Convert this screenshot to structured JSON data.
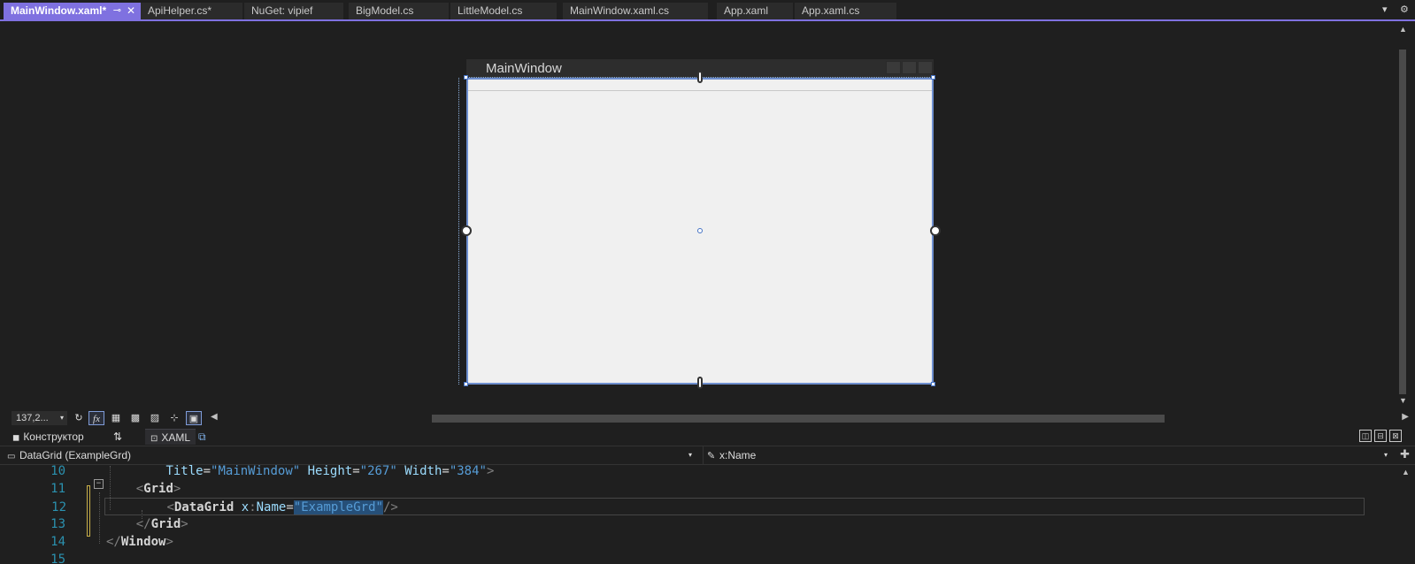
{
  "tabs": [
    {
      "label": "MainWindow.xaml*",
      "active": true
    },
    {
      "label": "ApiHelper.cs*"
    },
    {
      "label": "NuGet: vipief"
    },
    {
      "label": "BigModel.cs"
    },
    {
      "label": "LittleModel.cs"
    },
    {
      "label": "MainWindow.xaml.cs"
    },
    {
      "label": "App.xaml"
    },
    {
      "label": "App.xaml.cs"
    }
  ],
  "tab_icons": {
    "pin": "pin-icon",
    "close": "close-icon",
    "overflow": "chevron-down-icon",
    "settings": "gear-icon"
  },
  "tab_glyphs": {
    "pin": "⊸",
    "close": "✕",
    "overflow": "▾",
    "settings": "⚙"
  },
  "designer": {
    "window_title": "MainWindow",
    "colors": {
      "accent": "#7f71e0",
      "selection": "#6e8fcf",
      "window_background": "#f0f0f0"
    }
  },
  "designer_toolbar": {
    "zoom_value": "137,2...",
    "buttons": [
      {
        "name": "refresh-icon",
        "glyph": "↻"
      },
      {
        "name": "effects-toggle-icon",
        "glyph": "fx"
      },
      {
        "name": "grid-icon",
        "glyph": "▦"
      },
      {
        "name": "layout-grid-icon",
        "glyph": "▩"
      },
      {
        "name": "artboard-icon",
        "glyph": "▨"
      },
      {
        "name": "snap-icon",
        "glyph": "⊹"
      },
      {
        "name": "snap-gridlines-icon",
        "glyph": "▣"
      }
    ]
  },
  "split": {
    "designer_tab": "Конструктор",
    "swap_glyph": "⇅",
    "xaml_tab": "XAML",
    "popout_glyph": "⧉",
    "layout_buttons": [
      "◫",
      "⊟",
      "⊠"
    ]
  },
  "navbar": {
    "element": "DataGrid (ExampleGrd)",
    "member": "x:Name",
    "dropdown_glyph": "▾",
    "wrench_glyph": "✎",
    "element_glyph": "▭",
    "plus_glyph": "✚"
  },
  "code_lines": [
    {
      "number": "10",
      "indent": "        ",
      "tokens": [
        {
          "t": "Title",
          "c": "t-attr"
        },
        {
          "t": "=",
          "c": "t-eq"
        },
        {
          "t": "\"MainWindow\"",
          "c": "t-val"
        },
        {
          "t": " ",
          "c": "t-eq"
        },
        {
          "t": "Height",
          "c": "t-attr"
        },
        {
          "t": "=",
          "c": "t-eq"
        },
        {
          "t": "\"267\"",
          "c": "t-val"
        },
        {
          "t": " ",
          "c": "t-eq"
        },
        {
          "t": "Width",
          "c": "t-attr"
        },
        {
          "t": "=",
          "c": "t-eq"
        },
        {
          "t": "\"384\"",
          "c": "t-val"
        },
        {
          "t": ">",
          "c": "t-punc"
        }
      ]
    },
    {
      "number": "11",
      "indent": "    ",
      "tokens": [
        {
          "t": "<",
          "c": "t-punc"
        },
        {
          "t": "Grid",
          "c": "t-tag"
        },
        {
          "t": ">",
          "c": "t-punc"
        }
      ]
    },
    {
      "number": "12",
      "indent": "        ",
      "tokens": [
        {
          "t": "<",
          "c": "t-punc"
        },
        {
          "t": "DataGrid",
          "c": "t-tag"
        },
        {
          "t": " ",
          "c": "t-eq"
        },
        {
          "t": "x",
          "c": "t-ns"
        },
        {
          "t": ":",
          "c": "t-punc"
        },
        {
          "t": "Name",
          "c": "t-attr"
        },
        {
          "t": "=",
          "c": "t-eq"
        },
        {
          "t": "\"ExampleGrd\"",
          "c": "t-val hl"
        },
        {
          "t": "/>",
          "c": "t-punc"
        }
      ]
    },
    {
      "number": "13",
      "indent": "    ",
      "tokens": [
        {
          "t": "</",
          "c": "t-punc"
        },
        {
          "t": "Grid",
          "c": "t-tag"
        },
        {
          "t": ">",
          "c": "t-punc"
        }
      ]
    },
    {
      "number": "14",
      "indent": "",
      "tokens": [
        {
          "t": "</",
          "c": "t-punc"
        },
        {
          "t": "Window",
          "c": "t-tag"
        },
        {
          "t": ">",
          "c": "t-punc"
        }
      ]
    },
    {
      "number": "15",
      "indent": "",
      "tokens": []
    }
  ]
}
